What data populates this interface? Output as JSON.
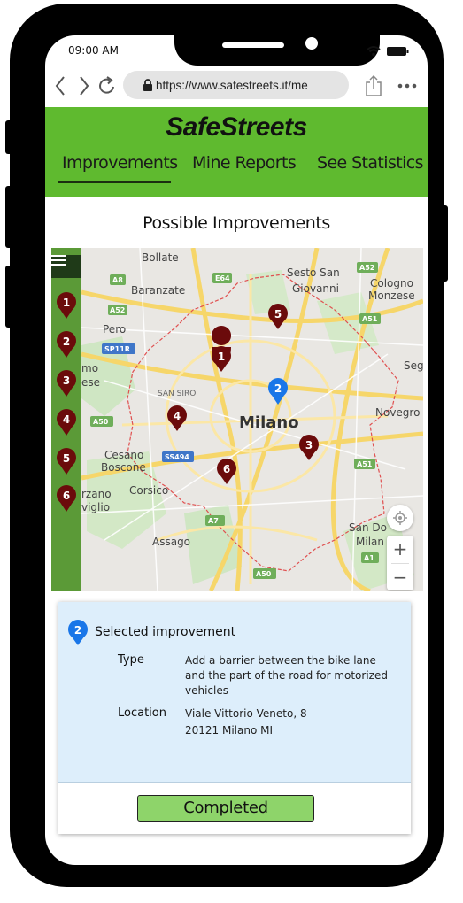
{
  "status_bar": {
    "time": "09:00 AM"
  },
  "browser": {
    "url": "https://www.safestreets.it/me"
  },
  "app": {
    "logo": "SafeStreets"
  },
  "tabs": [
    {
      "label": "Improvements",
      "active": true
    },
    {
      "label": "Mine Reports",
      "active": false
    },
    {
      "label": "See Statistics",
      "active": false
    }
  ],
  "page": {
    "title": "Possible Improvements"
  },
  "map": {
    "city_label": "Milano",
    "place_labels": [
      "Bollate",
      "Sesto San",
      "Giovanni",
      "Cologno",
      "Monzese",
      "Baranzate",
      "Pero",
      "SAN SIRO",
      "Novegro",
      "Cesano",
      "Boscone",
      "Corsico",
      "Assago",
      "San Do",
      "Milan",
      "Seg",
      "mo",
      "ese",
      "rzano",
      "viglio"
    ],
    "road_labels": [
      "A8",
      "E64",
      "A52",
      "A52",
      "A51",
      "SP11R",
      "A50",
      "SS494",
      "A51",
      "A7",
      "A1",
      "A50"
    ],
    "sidebar_pins": [
      "1",
      "2",
      "3",
      "4",
      "5",
      "6"
    ],
    "map_pins": [
      "1",
      "2",
      "3",
      "4",
      "5",
      "6"
    ],
    "selected_pin": "2",
    "zoom_in": "+",
    "zoom_out": "−",
    "colors": {
      "pin": "#6b0b0b",
      "selected_pin": "#1976e8",
      "sidebar": "#5b9a37"
    }
  },
  "selected_improvement": {
    "badge": "2",
    "title": "Selected improvement",
    "type_label": "Type",
    "type_value": "Add a barrier between the bike lane and the part of the road for motorized vehicles",
    "location_label": "Location",
    "location_line1": "Viale Vittorio Veneto, 8",
    "location_line2": "20121 Milano MI",
    "button": "Completed"
  },
  "colors": {
    "header": "#5fba2f",
    "card": "#ddeefb",
    "button": "#8ed46a"
  }
}
